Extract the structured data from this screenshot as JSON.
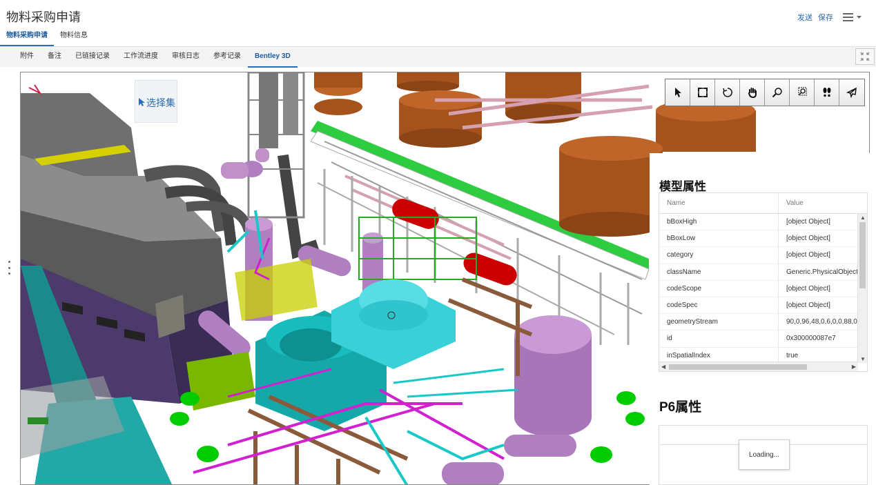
{
  "header": {
    "title": "物料采购申请",
    "send_label": "发送",
    "save_label": "保存"
  },
  "top_tabs": [
    {
      "label": "物料采购申请",
      "active": true
    },
    {
      "label": "物料信息",
      "active": false
    }
  ],
  "sub_tabs": [
    {
      "label": "附件"
    },
    {
      "label": "备注"
    },
    {
      "label": "已链接记录"
    },
    {
      "label": "工作流进度"
    },
    {
      "label": "审核日志"
    },
    {
      "label": "参考记录"
    },
    {
      "label": "Bentley 3D",
      "active": true
    }
  ],
  "viewer": {
    "selection_set_label": "选择集",
    "toolbar_icons": [
      "select-arrow-icon",
      "fit-view-icon",
      "rotate-icon",
      "pan-hand-icon",
      "zoom-icon",
      "zoom-window-icon",
      "walk-icon",
      "fly-icon"
    ]
  },
  "model_properties": {
    "heading": "模型属性",
    "columns": {
      "name": "Name",
      "value": "Value"
    },
    "rows": [
      {
        "name": "bBoxHigh",
        "value": "[object Object]"
      },
      {
        "name": "bBoxLow",
        "value": "[object Object]"
      },
      {
        "name": "category",
        "value": "[object Object]"
      },
      {
        "name": "className",
        "value": "Generic.PhysicalObject"
      },
      {
        "name": "codeScope",
        "value": "[object Object]"
      },
      {
        "name": "codeSpec",
        "value": "[object Object]"
      },
      {
        "name": "geometryStream",
        "value": "90,0,96,48,0,6,0,0,88,0,("
      },
      {
        "name": "id",
        "value": "0x300000087e7"
      },
      {
        "name": "inSpatialIndex",
        "value": "true"
      }
    ]
  },
  "p6_properties": {
    "heading": "P6属性",
    "loading_text": "Loading..."
  },
  "colors": {
    "accent": "#2c6bb5",
    "tank_brown": "#a5521c",
    "equipment_cyan": "#3ad0d8",
    "vessel_purple": "#b07fc0",
    "piping_green": "#22aa22"
  }
}
